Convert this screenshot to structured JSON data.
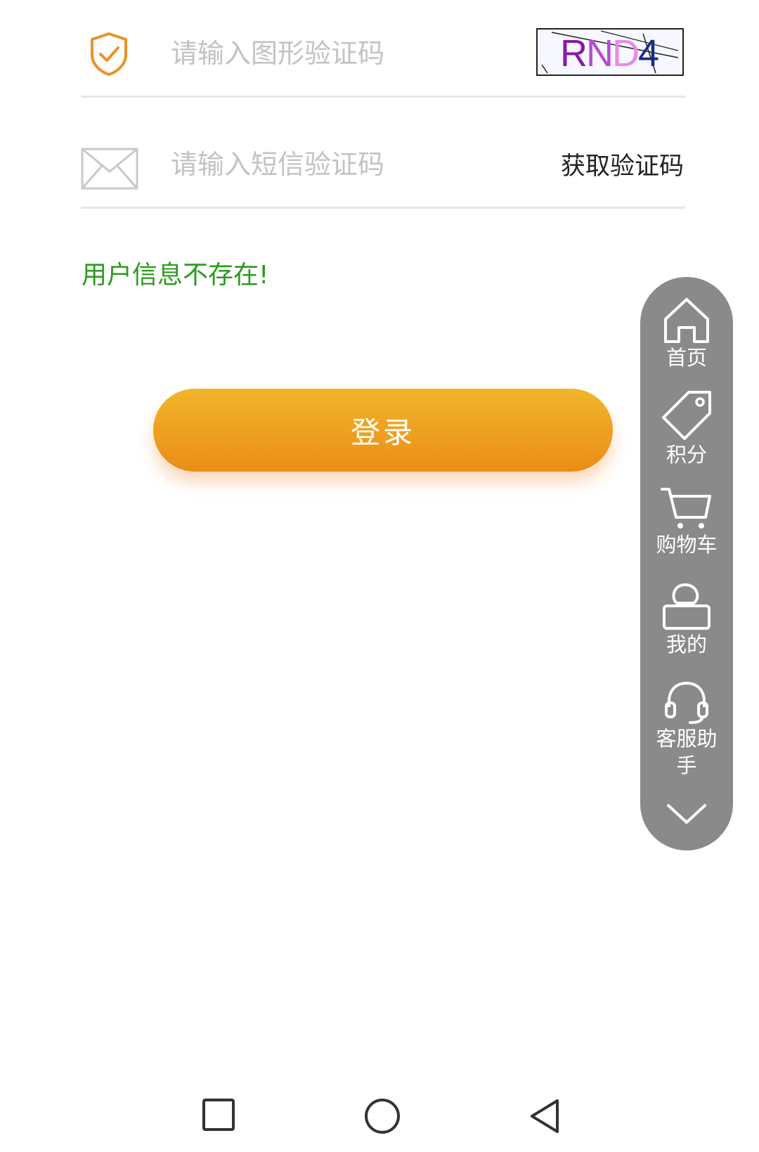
{
  "captcha": {
    "placeholder": "请输入图形验证码",
    "image_text_parts": [
      "R",
      "N",
      "D",
      "4"
    ],
    "image_colors": [
      "#8a1aa8",
      "#b64bd6",
      "#e88ae8",
      "#1a2a8a"
    ]
  },
  "sms": {
    "placeholder": "请输入短信验证码",
    "get_code_label": "获取验证码"
  },
  "error_message": "用户信息不存在!",
  "login_button": "登录",
  "side_nav": {
    "items": [
      {
        "icon": "home-icon",
        "label": "首页"
      },
      {
        "icon": "tag-icon",
        "label": "积分"
      },
      {
        "icon": "cart-icon",
        "label": "购物车"
      },
      {
        "icon": "user-icon",
        "label": "我的"
      },
      {
        "icon": "headset-icon",
        "label": "客服助手"
      }
    ],
    "collapse_icon": "chevron-down-icon"
  },
  "colors": {
    "accent_orange": "#ec8c18",
    "error_green": "#2c9a1f",
    "side_nav_bg": "#8a8a8a"
  },
  "system_nav": [
    "recent-apps-icon",
    "home-circle-icon",
    "back-icon"
  ]
}
